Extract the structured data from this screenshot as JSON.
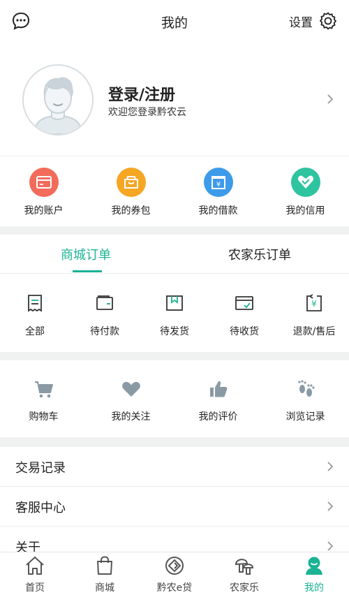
{
  "header": {
    "title": "我的",
    "settings_label": "设置"
  },
  "profile": {
    "title": "登录/注册",
    "subtitle": "欢迎您登录黔农云"
  },
  "finance": [
    {
      "label": "我的账户",
      "icon": "wallet-icon",
      "color": "#f26b5b"
    },
    {
      "label": "我的券包",
      "icon": "coupon-bag-icon",
      "color": "#f5a623"
    },
    {
      "label": "我的借款",
      "icon": "loan-icon",
      "color": "#3d9be9"
    },
    {
      "label": "我的信用",
      "icon": "credit-heart-icon",
      "color": "#2ec4a0"
    }
  ],
  "order_tabs": {
    "active": "商城订单",
    "other": "农家乐订单"
  },
  "orders": [
    {
      "label": "全部",
      "icon": "receipt-icon"
    },
    {
      "label": "待付款",
      "icon": "wallet-outline-icon"
    },
    {
      "label": "待发货",
      "icon": "package-icon"
    },
    {
      "label": "待收货",
      "icon": "card-check-icon"
    },
    {
      "label": "退款/售后",
      "icon": "refund-icon"
    }
  ],
  "tools": [
    {
      "label": "购物车",
      "icon": "cart-icon"
    },
    {
      "label": "我的关注",
      "icon": "heart-icon"
    },
    {
      "label": "我的评价",
      "icon": "thumbs-up-icon"
    },
    {
      "label": "浏览记录",
      "icon": "footprint-icon"
    }
  ],
  "menu": [
    {
      "label": "交易记录"
    },
    {
      "label": "客服中心"
    },
    {
      "label": "关于"
    }
  ],
  "tabbar": [
    {
      "label": "首页",
      "icon": "home-icon"
    },
    {
      "label": "商城",
      "icon": "shopping-bag-icon"
    },
    {
      "label": "黔农e贷",
      "icon": "loan-circle-icon"
    },
    {
      "label": "农家乐",
      "icon": "mushroom-icon"
    },
    {
      "label": "我的",
      "icon": "user-icon",
      "active": true
    }
  ],
  "colors": {
    "accent": "#1ab394"
  }
}
